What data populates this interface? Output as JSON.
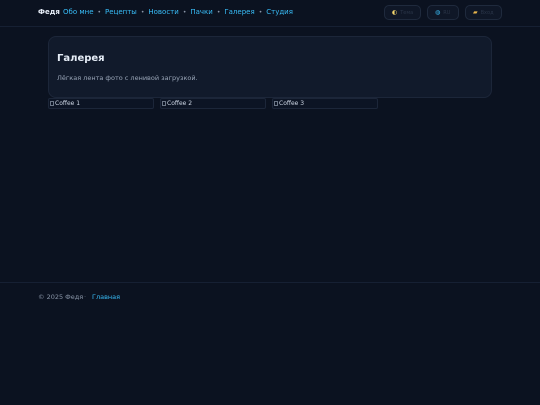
{
  "header": {
    "brand": "Федя",
    "nav": [
      {
        "label": "Обо мне"
      },
      {
        "label": "Рецепты"
      },
      {
        "label": "Новости"
      },
      {
        "label": "Пачки"
      },
      {
        "label": "Галерея"
      },
      {
        "label": "Студия"
      }
    ],
    "nav_separator": "•",
    "buttons": {
      "theme_icon": "half-moon-icon",
      "theme_label": "Тема",
      "lang_icon": "globe-icon",
      "lang_label": "RU",
      "folder_icon": "folder-icon",
      "folder_label": "Вход"
    }
  },
  "main": {
    "title": "Галерея",
    "subtitle": "Лёгкая лента фото с ленивой загрузкой.",
    "images": [
      {
        "alt": "Coffee 1"
      },
      {
        "alt": "Coffee 2"
      },
      {
        "alt": "Coffee 3"
      }
    ]
  },
  "footer": {
    "copyright": "© 2025 Федя",
    "separator": "·",
    "home_link": "Главная"
  },
  "colors": {
    "background": "#0b1220",
    "accent": "#38bdf8",
    "card": "#111a2b"
  }
}
